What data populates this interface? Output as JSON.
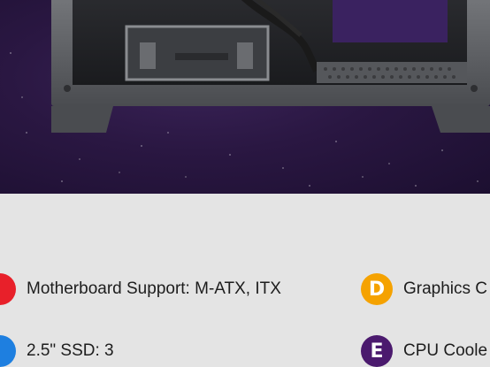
{
  "hero": {
    "image": "pc-case-interior-photo"
  },
  "specs": [
    {
      "letter": "",
      "label": "Motherboard Support: M-ATX, ITX",
      "color": "#e8202a",
      "icon": "spec-a-badge-icon"
    },
    {
      "letter": "",
      "label": "2.5\" SSD: 3",
      "color": "#1e7fe0",
      "icon": "spec-b-badge-icon"
    },
    {
      "letter": "D",
      "label": "Graphics C",
      "color": "#f5a200",
      "icon": "spec-d-badge-icon"
    },
    {
      "letter": "E",
      "label": "CPU Coole",
      "color": "#4b1a6e",
      "icon": "spec-e-badge-icon"
    }
  ],
  "colors": {
    "background": "#e4e4e4",
    "hero_bg": "#2a1742",
    "case_metal": "#5b5d61"
  }
}
